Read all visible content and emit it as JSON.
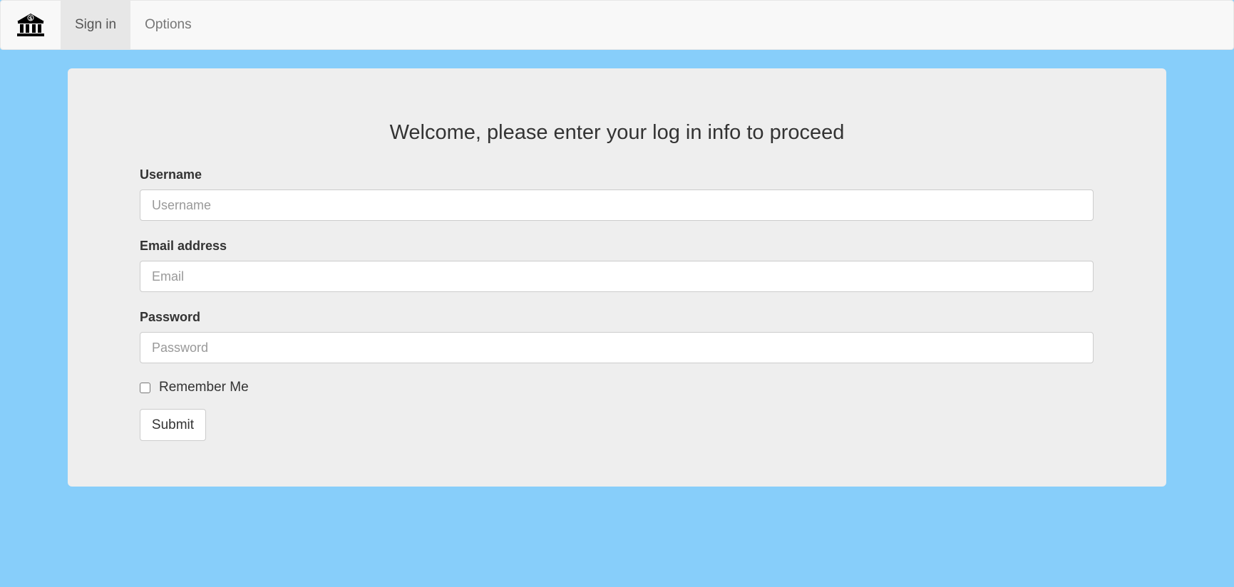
{
  "nav": {
    "brand_icon": "bank-icon",
    "items": [
      {
        "label": "Sign in",
        "active": true
      },
      {
        "label": "Options",
        "active": false
      }
    ]
  },
  "form": {
    "title": "Welcome, please enter your log in info to proceed",
    "username": {
      "label": "Username",
      "placeholder": "Username",
      "value": ""
    },
    "email": {
      "label": "Email address",
      "placeholder": "Email",
      "value": ""
    },
    "password": {
      "label": "Password",
      "placeholder": "Password",
      "value": ""
    },
    "remember": {
      "label": "Remember Me",
      "checked": false
    },
    "submit_label": "Submit"
  },
  "colors": {
    "page_background": "#87cefa",
    "navbar_background": "#f8f8f8",
    "active_nav_background": "#e7e7e7",
    "card_background": "#eeeeee"
  }
}
